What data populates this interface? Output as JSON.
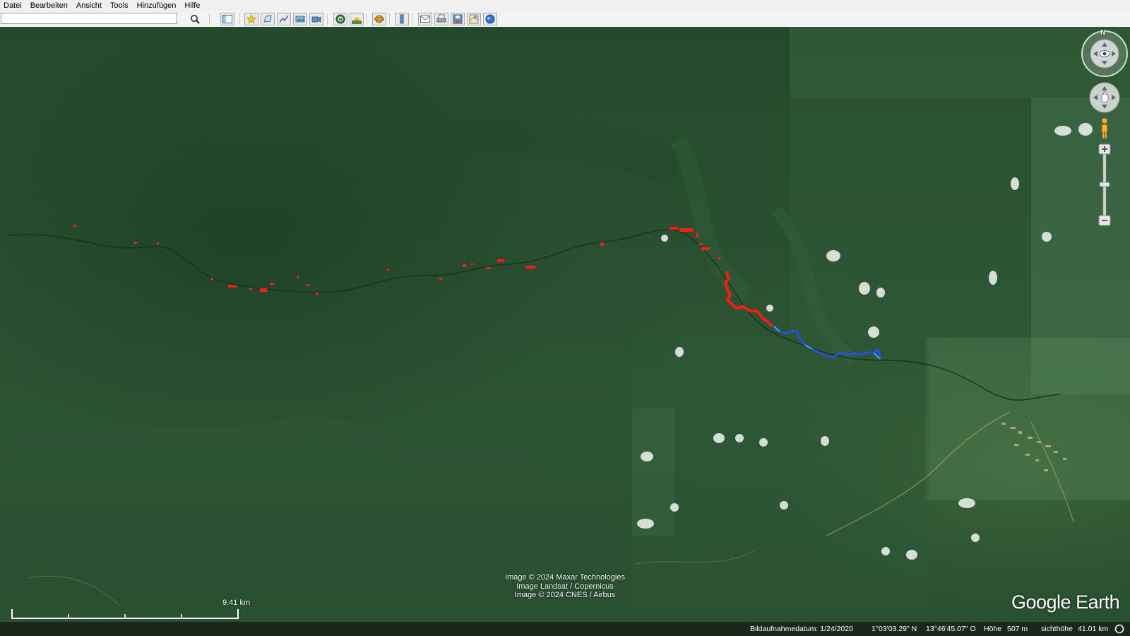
{
  "menu": {
    "items": [
      "Datei",
      "Bearbeiten",
      "Ansicht",
      "Tools",
      "Hinzufügen",
      "Hilfe"
    ]
  },
  "toolbar": {
    "search_value": "",
    "search_button_icon": "magnifier-icon",
    "buttons": [
      "sidebar-toggle-icon",
      "placemark-icon",
      "polygon-icon",
      "path-icon",
      "image-overlay-icon",
      "record-tour-icon",
      "historical-imagery-icon",
      "sunlight-icon",
      "switch-to-sky-icon",
      "ruler-icon",
      "email-icon",
      "print-icon",
      "save-image-icon",
      "view-in-maps-icon",
      "earth-icon"
    ]
  },
  "map": {
    "attribution": [
      "Image © 2024 Maxar Technologies",
      "Image Landsat / Copernicus",
      "Image © 2024 CNES / Airbus"
    ],
    "scale_label": "9.41  km",
    "logo": "Google Earth",
    "compass_letter": "N"
  },
  "status": {
    "imagery_date": "Bildaufnahmedatum: 1/24/2020",
    "latitude": "1°03'03.29\" N",
    "longitude": "13°46'45.07\" O",
    "elevation_label": "Höhe",
    "elevation_value": "507 m",
    "eye_alt_label": "sichthöhe",
    "eye_alt_value": "41.01 km"
  },
  "colors": {
    "track_red": "#ff1a1a",
    "track_blue": "#1f4dff",
    "track_light_blue": "#39a0ff",
    "forest": "#2a5232"
  }
}
